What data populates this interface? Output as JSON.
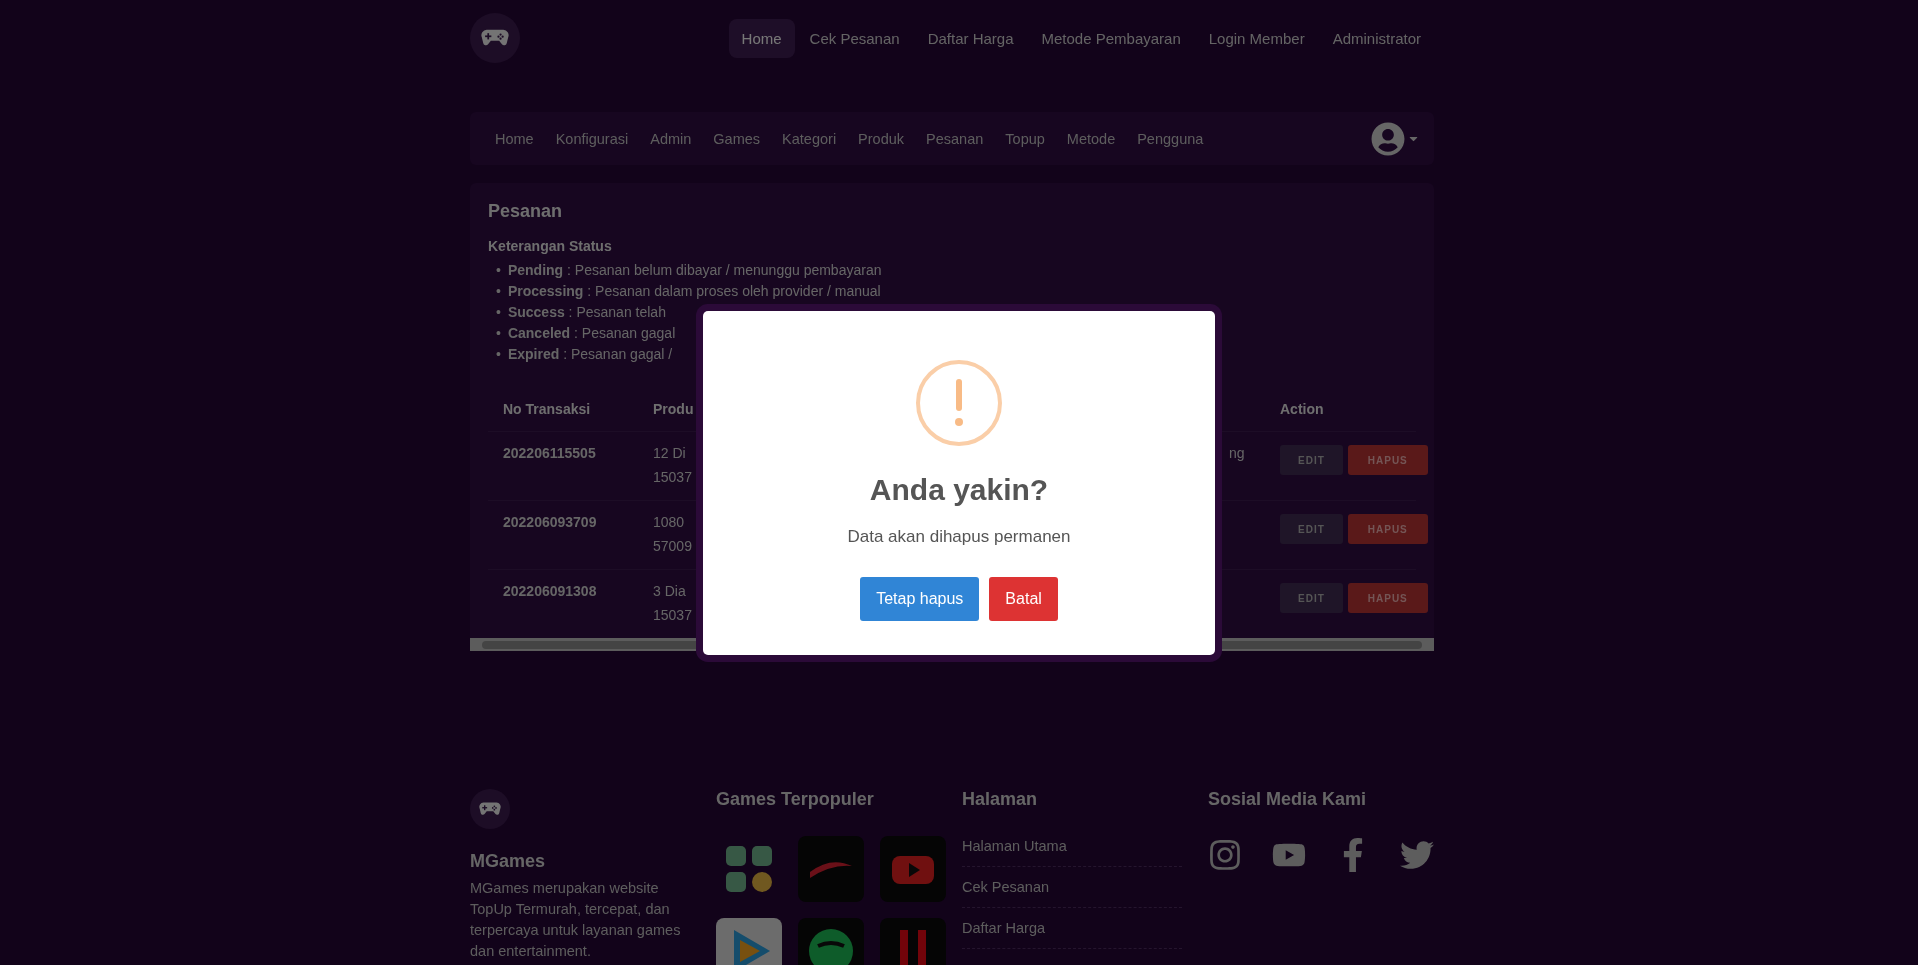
{
  "top_nav": {
    "items": [
      {
        "label": "Home",
        "selected": true
      },
      {
        "label": "Cek Pesanan",
        "selected": false
      },
      {
        "label": "Daftar Harga",
        "selected": false
      },
      {
        "label": "Metode Pembayaran",
        "selected": false
      },
      {
        "label": "Login Member",
        "selected": false
      },
      {
        "label": "Administrator",
        "selected": false
      }
    ]
  },
  "admin_nav": {
    "items": [
      "Home",
      "Konfigurasi",
      "Admin",
      "Games",
      "Kategori",
      "Produk",
      "Pesanan",
      "Topup",
      "Metode",
      "Pengguna"
    ]
  },
  "page_title": "Pesanan",
  "status_legend": {
    "title": "Keterangan Status",
    "bullet": "•",
    "items": [
      "**Pending** : Pesanan belum dibayar / menunggu pembayaran",
      "**Processing** : Pesanan dalam proses oleh provider / manual",
      "**Success** : Pesanan telah",
      "**Canceled** : Pesanan gagal",
      "**Expired** : Pesanan gagal /"
    ]
  },
  "table": {
    "columns": [
      "No Transaksi",
      "Produ",
      "Action"
    ],
    "rows": [
      {
        "id": "202206115505",
        "product": [
          "12 Di",
          "15037"
        ],
        "column_3": "ng",
        "actions": [
          "EDIT",
          "HAPUS"
        ]
      },
      {
        "id": "202206093709",
        "product": [
          "1080",
          "57009"
        ],
        "actions": [
          "EDIT",
          "HAPUS"
        ]
      },
      {
        "id": "202206091308",
        "product": [
          "3 Dia",
          "15037"
        ],
        "actions": [
          "EDIT",
          "HAPUS"
        ]
      }
    ]
  },
  "modal": {
    "title": "Anda yakin?",
    "text": "Data akan dihapus permanen",
    "buttons": [
      {
        "label": "Tetap hapus",
        "kind": "confirm"
      },
      {
        "label": "Batal",
        "kind": "cancel"
      }
    ]
  },
  "footer": {
    "brand": "MGames",
    "description": "MGames merupakan website TopUp Termurah, tercepat, dan terpercaya untuk layanan games dan entertainment.",
    "games_title": "Games Terpopuler",
    "games": [
      {
        "kind": "grid"
      },
      {
        "kind": "swoosh"
      },
      {
        "kind": "play"
      },
      {
        "kind": "triangle"
      },
      {
        "kind": "wave"
      },
      {
        "kind": "stripes"
      }
    ],
    "pages_title": "Halaman",
    "pages": [
      "Halaman Utama",
      "Cek Pesanan",
      "Daftar Harga"
    ],
    "social_title": "Sosial Media Kami",
    "social": [
      {
        "kind": "instagram"
      },
      {
        "kind": "youtube"
      },
      {
        "kind": "facebook"
      },
      {
        "kind": "twitter"
      }
    ]
  }
}
